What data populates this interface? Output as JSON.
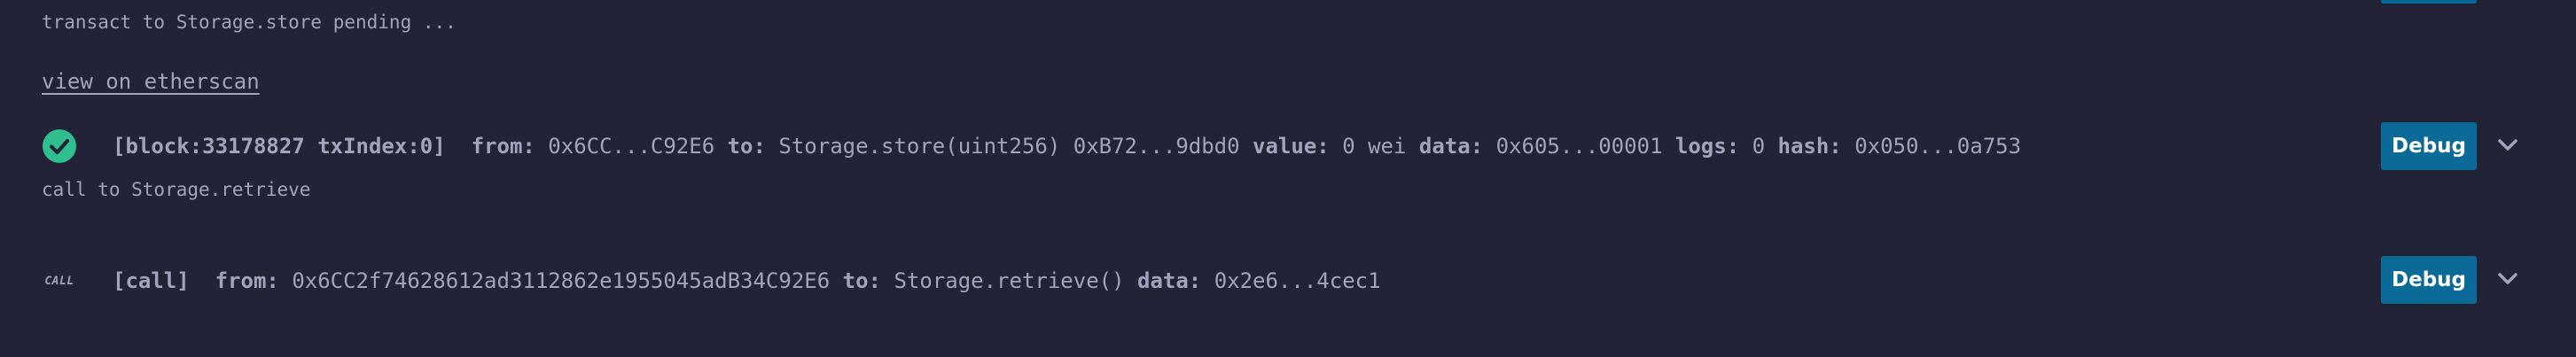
{
  "log": {
    "pending": "transact to Storage.store pending ...",
    "etherscan_link": "view on etherscan",
    "call_retrieve": "call to Storage.retrieve"
  },
  "tx1": {
    "status": "success",
    "block": "[block:33178827 txIndex:0]",
    "from_label": "from:",
    "from": "0x6CC...C92E6",
    "to_label": "to:",
    "to": "Storage.store(uint256) 0xB72...9dbd0",
    "value_label": "value:",
    "value": "0 wei",
    "data_label": "data:",
    "data": "0x605...00001",
    "logs_label": "logs:",
    "logs": "0",
    "hash_label": "hash:",
    "hash": "0x050...0a753",
    "debug_label": "Debug"
  },
  "tx2": {
    "tag": "CALL",
    "kind": "[call]",
    "from_label": "from:",
    "from": "0x6CC2f74628612ad3112862e1955045adB34C92E6",
    "to_label": "to:",
    "to": "Storage.retrieve()",
    "data_label": "data:",
    "data": "0x2e6...4cec1",
    "debug_label": "Debug"
  },
  "colors": {
    "background": "#222336",
    "text": "#a2a3bd",
    "success": "#2fbf8f",
    "debug_button": "#0b6a98"
  },
  "icons": {
    "success": "check-circle-icon",
    "expand": "chevron-down-icon"
  }
}
